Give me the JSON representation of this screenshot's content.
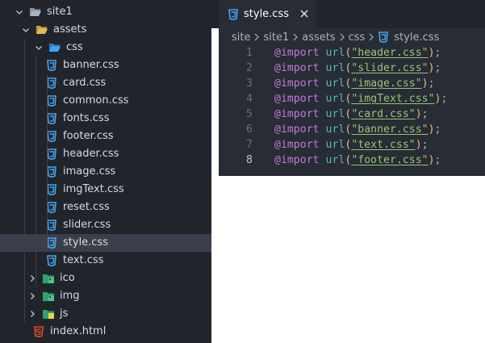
{
  "explorer": {
    "items": [
      {
        "label": "site1",
        "kind": "folder-open",
        "chevron": "down",
        "icon": "folder-open-icon",
        "selected": false
      },
      {
        "label": "assets",
        "kind": "folder-open",
        "chevron": "down",
        "icon": "folder-open-yellow-icon",
        "selected": false
      },
      {
        "label": "css",
        "kind": "folder-open",
        "chevron": "down",
        "icon": "css-folder-open-icon",
        "selected": false
      },
      {
        "label": "banner.css",
        "kind": "file",
        "icon": "css-file-icon",
        "selected": false
      },
      {
        "label": "card.css",
        "kind": "file",
        "icon": "css-file-icon",
        "selected": false
      },
      {
        "label": "common.css",
        "kind": "file",
        "icon": "css-file-icon",
        "selected": false
      },
      {
        "label": "fonts.css",
        "kind": "file",
        "icon": "css-file-icon",
        "selected": false
      },
      {
        "label": "footer.css",
        "kind": "file",
        "icon": "css-file-icon",
        "selected": false
      },
      {
        "label": "header.css",
        "kind": "file",
        "icon": "css-file-icon",
        "selected": false
      },
      {
        "label": "image.css",
        "kind": "file",
        "icon": "css-file-icon",
        "selected": false
      },
      {
        "label": "imgText.css",
        "kind": "file",
        "icon": "css-file-icon",
        "selected": false
      },
      {
        "label": "reset.css",
        "kind": "file",
        "icon": "css-file-icon",
        "selected": false
      },
      {
        "label": "slider.css",
        "kind": "file",
        "icon": "css-file-icon",
        "selected": false
      },
      {
        "label": "style.css",
        "kind": "file",
        "icon": "css-file-icon",
        "selected": true
      },
      {
        "label": "text.css",
        "kind": "file",
        "icon": "css-file-icon",
        "selected": false
      },
      {
        "label": "ico",
        "kind": "folder",
        "chevron": "right",
        "icon": "image-folder-icon",
        "selected": false
      },
      {
        "label": "img",
        "kind": "folder",
        "chevron": "right",
        "icon": "image-folder-icon",
        "selected": false
      },
      {
        "label": "js",
        "kind": "folder",
        "chevron": "right",
        "icon": "js-folder-icon",
        "selected": false
      },
      {
        "label": "index.html",
        "kind": "file",
        "icon": "html-file-icon",
        "selected": false
      }
    ]
  },
  "tab": {
    "label": "style.css",
    "icon": "css-file-icon",
    "close_icon": "close-icon"
  },
  "breadcrumb": [
    "site",
    "site1",
    "assets",
    "css",
    "style.css"
  ],
  "editor": {
    "lines": [
      {
        "num": "1",
        "kw": "@import",
        "fn": "url",
        "str": "\"header.css\""
      },
      {
        "num": "2",
        "kw": "@import",
        "fn": "url",
        "str": "\"slider.css\""
      },
      {
        "num": "3",
        "kw": "@import",
        "fn": "url",
        "str": "\"image.css\""
      },
      {
        "num": "4",
        "kw": "@import",
        "fn": "url",
        "str": "\"imgText.css\""
      },
      {
        "num": "5",
        "kw": "@import",
        "fn": "url",
        "str": "\"card.css\""
      },
      {
        "num": "6",
        "kw": "@import",
        "fn": "url",
        "str": "\"banner.css\""
      },
      {
        "num": "7",
        "kw": "@import",
        "fn": "url",
        "str": "\"text.css\""
      },
      {
        "num": "8",
        "kw": "@import",
        "fn": "url",
        "str": "\"footer.css\""
      }
    ],
    "current_line": "8"
  },
  "colors": {
    "sidebar_bg": "#21252b",
    "editor_bg": "#282c34",
    "selection": "#3a3f4b",
    "css_icon": "#42a5f5",
    "folder_yellow": "#e5b85a",
    "html_icon": "#e44d26",
    "keyword": "#c678dd",
    "function": "#56b6c2",
    "string": "#98c379"
  }
}
